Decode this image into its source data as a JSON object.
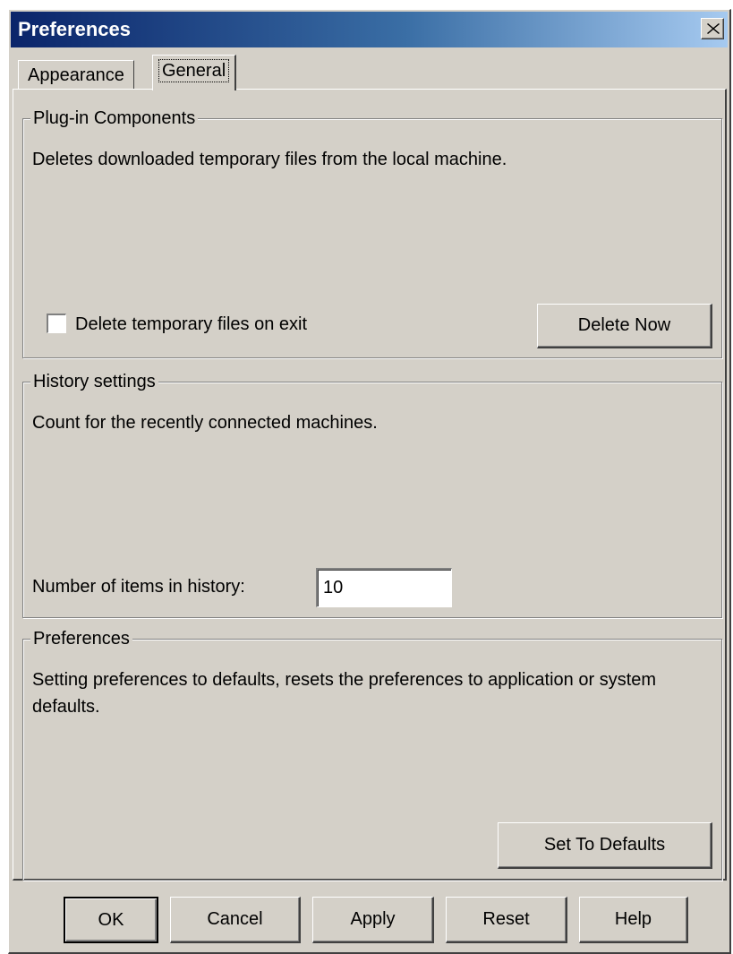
{
  "window": {
    "title": "Preferences"
  },
  "tabs": [
    {
      "label": "Appearance",
      "selected": false
    },
    {
      "label": "General",
      "selected": true
    }
  ],
  "plugin": {
    "legend": "Plug-in Components",
    "description": "Deletes downloaded temporary files from the local machine.",
    "checkbox_label": "Delete temporary files on exit",
    "checkbox_checked": false,
    "delete_button": "Delete Now"
  },
  "history": {
    "legend": "History settings",
    "description": "Count for the recently connected machines.",
    "count_label": "Number of items in history:",
    "count_value": "10"
  },
  "prefs": {
    "legend": "Preferences",
    "description": "Setting preferences to defaults, resets the preferences to application or system defaults.",
    "defaults_button": "Set To Defaults"
  },
  "footer": {
    "ok": "OK",
    "cancel": "Cancel",
    "apply": "Apply",
    "reset": "Reset",
    "help": "Help"
  },
  "colors": {
    "face": "#d4d0c8",
    "titlebar_start": "#0a246a",
    "titlebar_end": "#a6caf0"
  }
}
